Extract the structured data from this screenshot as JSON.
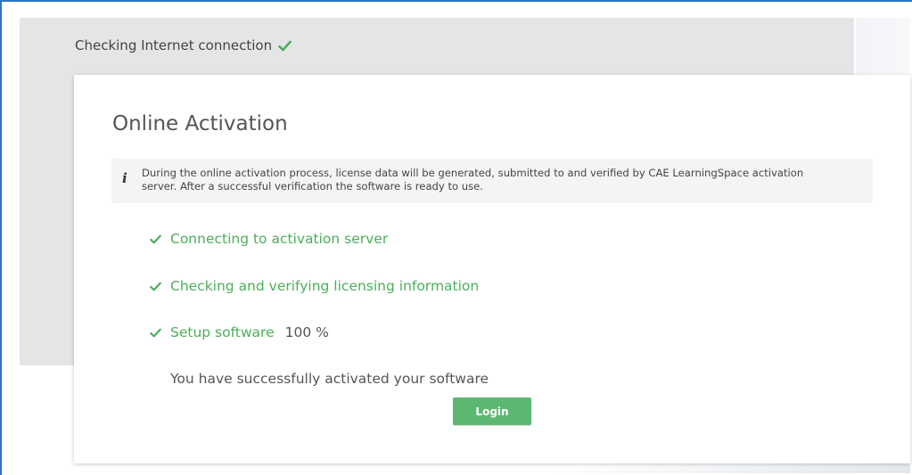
{
  "header": {
    "status_text": "Checking Internet connection",
    "status_icon": "check-icon"
  },
  "card": {
    "title": "Online Activation",
    "info": {
      "icon": "info-icon",
      "icon_glyph": "i",
      "line1": "During the online activation process, license data will be generated, submitted to and verified by CAE LearningSpace activation",
      "line2": "server. After a successful verification the software is ready to use."
    },
    "steps": [
      {
        "label": "Connecting to activation server",
        "status": "done"
      },
      {
        "label": "Checking and verifying licensing information",
        "status": "done"
      },
      {
        "label": "Setup software",
        "status": "done",
        "progress": "100 %"
      }
    ],
    "success_message": "You have successfully activated your software",
    "login_label": "Login"
  },
  "colors": {
    "accent_green": "#4cae5c",
    "button_green": "#5cb870",
    "frame_blue": "#2e74c4",
    "panel_gray": "#e4e5e6"
  }
}
